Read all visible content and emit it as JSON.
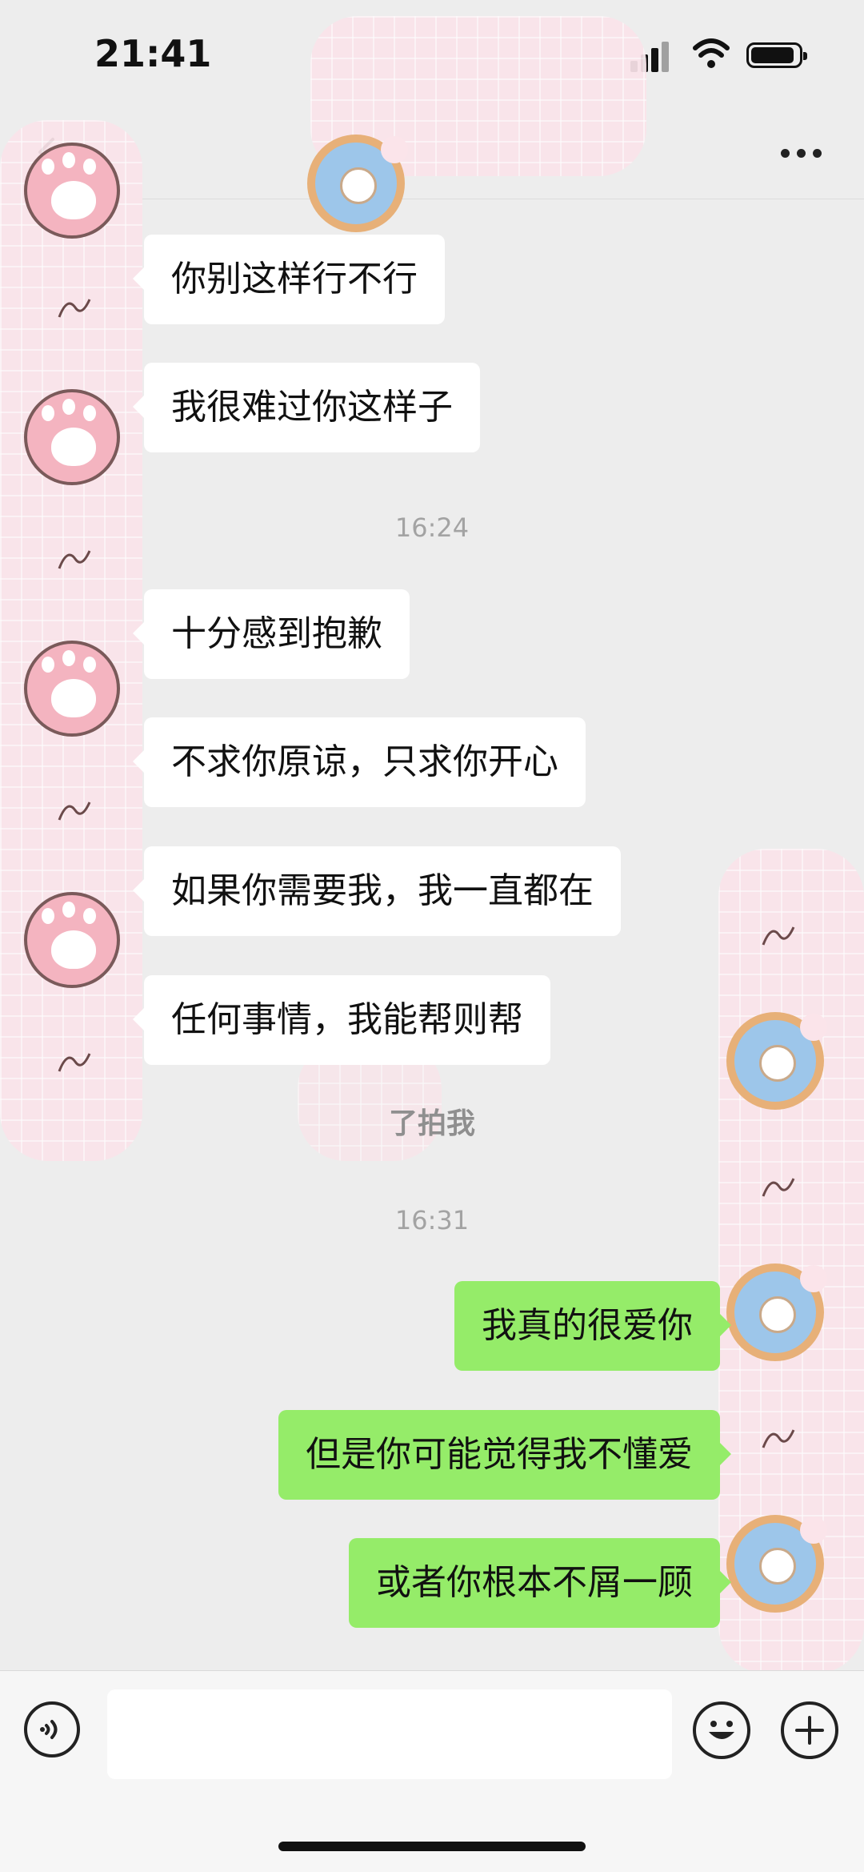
{
  "status_bar": {
    "time": "21:41"
  },
  "nav": {
    "back_icon": "chevron-left-icon",
    "more_icon": "more-dots-icon"
  },
  "messages": [
    {
      "side": "left",
      "text": "你别这样行不行"
    },
    {
      "side": "left",
      "text": "我很难过你这样子"
    },
    {
      "type": "time",
      "text": "16:24"
    },
    {
      "side": "left",
      "text": "十分感到抱歉"
    },
    {
      "side": "left",
      "text": "不求你原谅，只求你开心"
    },
    {
      "side": "left",
      "text": "如果你需要我，我一直都在"
    },
    {
      "side": "left",
      "text": "任何事情，我能帮则帮"
    },
    {
      "type": "notice",
      "text": "了拍我"
    },
    {
      "type": "time",
      "text": "16:31"
    },
    {
      "side": "right",
      "text": "我真的很爱你"
    },
    {
      "side": "right",
      "text": "但是你可能觉得我不懂爱"
    },
    {
      "side": "right",
      "text": "或者你根本不屑一顾"
    }
  ],
  "input_bar": {
    "voice_icon": "voice-icon",
    "emoji_icon": "emoji-icon",
    "plus_icon": "plus-icon",
    "text_value": ""
  },
  "colors": {
    "background": "#ededed",
    "bubble_in": "#ffffff",
    "bubble_out": "#95ec69"
  }
}
